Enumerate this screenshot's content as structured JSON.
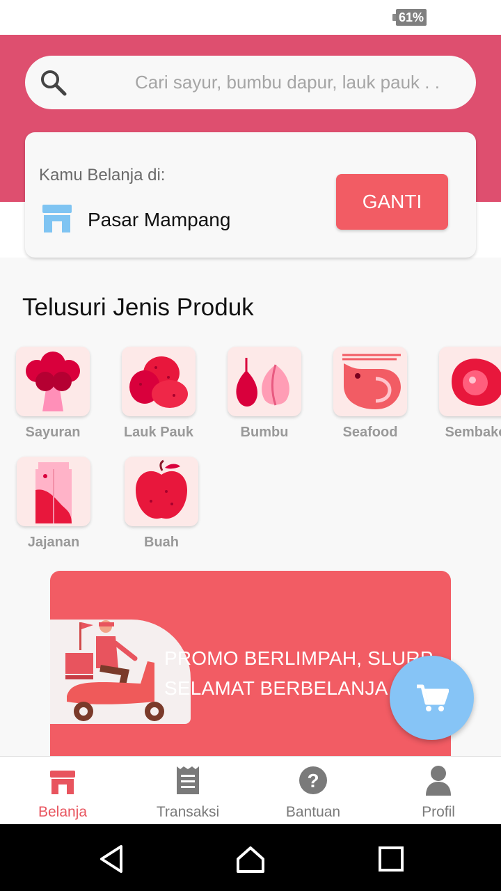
{
  "status_bar": {
    "battery": "61%"
  },
  "search": {
    "placeholder": "Cari sayur, bumbu dapur, lauk pauk . ."
  },
  "market": {
    "caption": "Kamu Belanja di:",
    "name": "Pasar Mampang",
    "change_label": "GANTI"
  },
  "section_title": "Telusuri Jenis Produk",
  "categories": [
    {
      "label": "Sayuran",
      "icon": "broccoli-icon"
    },
    {
      "label": "Lauk Pauk",
      "icon": "potato-icon"
    },
    {
      "label": "Bumbu",
      "icon": "garlic-onion-icon"
    },
    {
      "label": "Seafood",
      "icon": "shrimp-icon"
    },
    {
      "label": "Sembako",
      "icon": "egg-icon"
    },
    {
      "label": "Jajanan",
      "icon": "milk-carton-icon"
    },
    {
      "label": "Buah",
      "icon": "apple-icon"
    }
  ],
  "promo": {
    "line1": "PROMO BERLIMPAH, SLURP",
    "line2": "SELAMAT BERBELANJA"
  },
  "bottom_nav": [
    {
      "label": "Belanja",
      "icon": "store-icon",
      "active": true
    },
    {
      "label": "Transaksi",
      "icon": "receipt-icon"
    },
    {
      "label": "Bantuan",
      "icon": "help-icon"
    },
    {
      "label": "Profil",
      "icon": "person-icon"
    }
  ],
  "colors": {
    "header": "#de4f6f",
    "accent": "#f25c64",
    "cart_fab": "#86c4f6",
    "tile": "#fde9e8"
  }
}
